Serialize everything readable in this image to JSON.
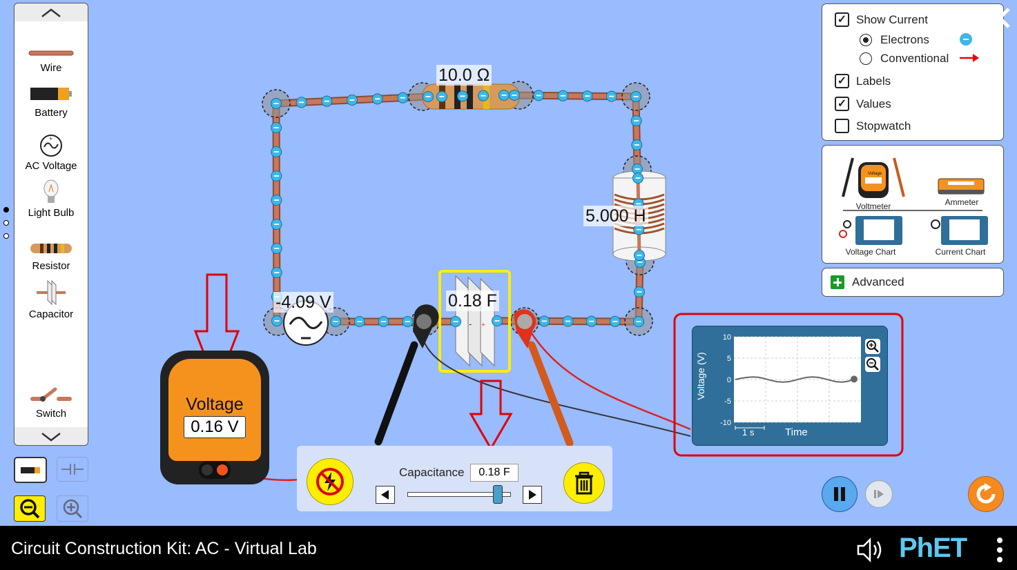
{
  "toolbox": {
    "items": [
      {
        "label": "Wire"
      },
      {
        "label": "Battery"
      },
      {
        "label": "AC Voltage"
      },
      {
        "label": "Light Bulb"
      },
      {
        "label": "Resistor"
      },
      {
        "label": "Capacitor"
      },
      {
        "label": "Switch"
      }
    ]
  },
  "display_options": {
    "show_current": "Show Current",
    "electrons": "Electrons",
    "conventional": "Conventional",
    "labels": "Labels",
    "values": "Values",
    "stopwatch": "Stopwatch",
    "show_current_checked": true,
    "labels_checked": true,
    "values_checked": true,
    "stopwatch_checked": false,
    "current_mode": "Electrons"
  },
  "sensors": {
    "voltmeter": "Voltmeter",
    "ammeter": "Ammeter",
    "voltage_chart": "Voltage Chart",
    "current_chart": "Current Chart"
  },
  "advanced": {
    "label": "Advanced"
  },
  "circuit": {
    "resistor_value": "10.0 Ω",
    "inductor_value": "5.000 H",
    "ac_source_value": "-4.09 V",
    "capacitor_value": "0.18 F"
  },
  "voltmeter": {
    "title": "Voltage",
    "reading": "0.16 V"
  },
  "edit_panel": {
    "label": "Capacitance",
    "value": "0.18 F",
    "slider_fraction": 0.87
  },
  "voltage_chart": {
    "ylabel": "Voltage (V)",
    "xlabel": "Time",
    "ticks": [
      "10",
      "5",
      "0",
      "-5",
      "-10"
    ],
    "scale_label": "1 s"
  },
  "footer": {
    "title": "Circuit Construction Kit: AC - Virtual Lab",
    "brand": "PhET"
  },
  "colors": {
    "background": "#99bbff",
    "highlight": "#ffee00",
    "annotation_red": "#e00000",
    "electron": "#3db7e8"
  },
  "chart_data": {
    "type": "line",
    "xlabel": "Time",
    "ylabel": "Voltage (V)",
    "ylim": [
      -10,
      10
    ],
    "x": [
      0,
      1,
      2,
      3,
      4,
      5,
      6,
      7,
      8,
      9,
      10,
      11,
      12,
      13,
      14,
      15,
      16,
      17,
      18,
      19,
      20
    ],
    "series": [
      {
        "values": [
          0,
          0.3,
          0.5,
          0.6,
          0.5,
          0.2,
          -0.2,
          -0.5,
          -0.6,
          -0.5,
          -0.2,
          0.2,
          0.5,
          0.6,
          0.5,
          0.2,
          -0.2,
          -0.5,
          -0.6,
          -0.4,
          0.1
        ]
      }
    ]
  }
}
